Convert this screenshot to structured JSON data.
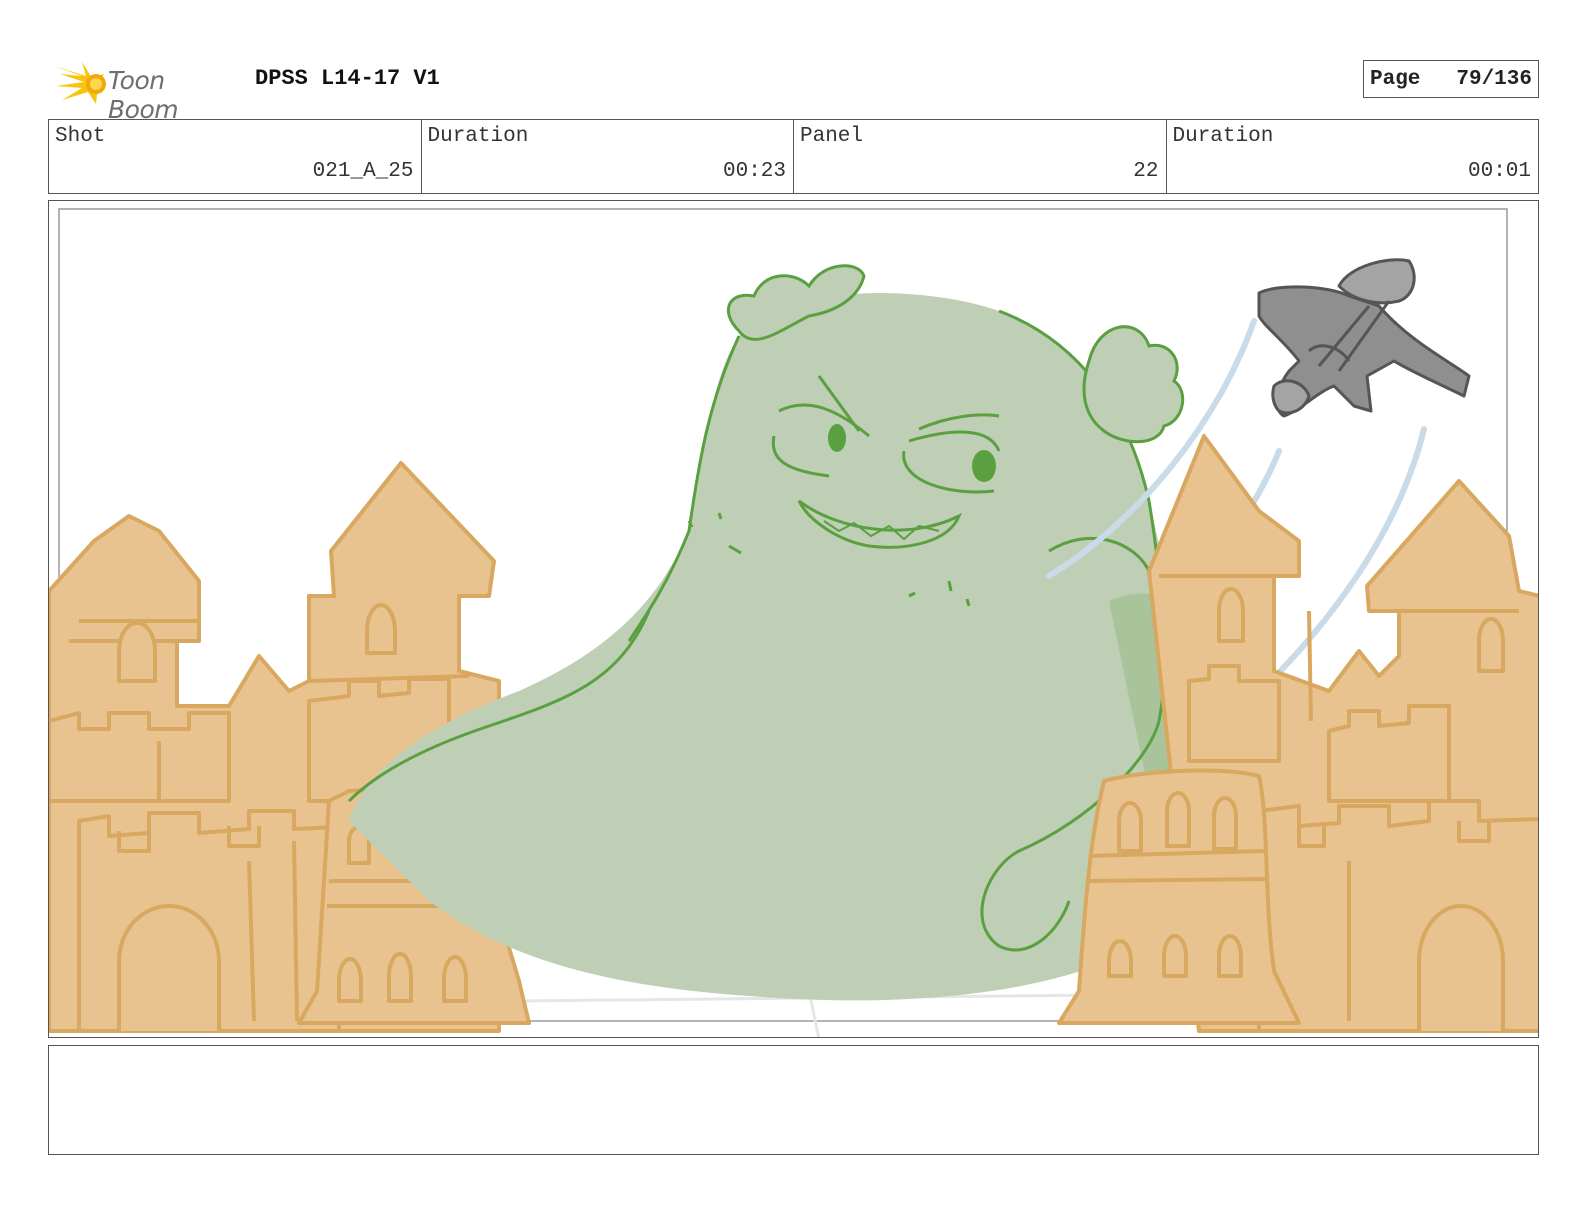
{
  "header": {
    "logo_text": "Toon Boom",
    "title": "DPSS L14-17 V1",
    "page_label": "Page",
    "page_value": "79/136"
  },
  "info": {
    "shot_label": "Shot",
    "shot_value": "021_A_25",
    "shot_duration_label": "Duration",
    "shot_duration_value": "00:23",
    "panel_label": "Panel",
    "panel_value": "22",
    "panel_duration_label": "Duration",
    "panel_duration_value": "00:01"
  },
  "colors": {
    "sand_fill": "#e8c38f",
    "sand_line": "#d9a860",
    "monster_fill": "#bfcfb5",
    "monster_line": "#5aa040",
    "plane_fill": "#8f8f8f",
    "speed_lines": "#c9dbe8",
    "logo_star": "#f4c20d"
  },
  "notes": {
    "text": ""
  }
}
